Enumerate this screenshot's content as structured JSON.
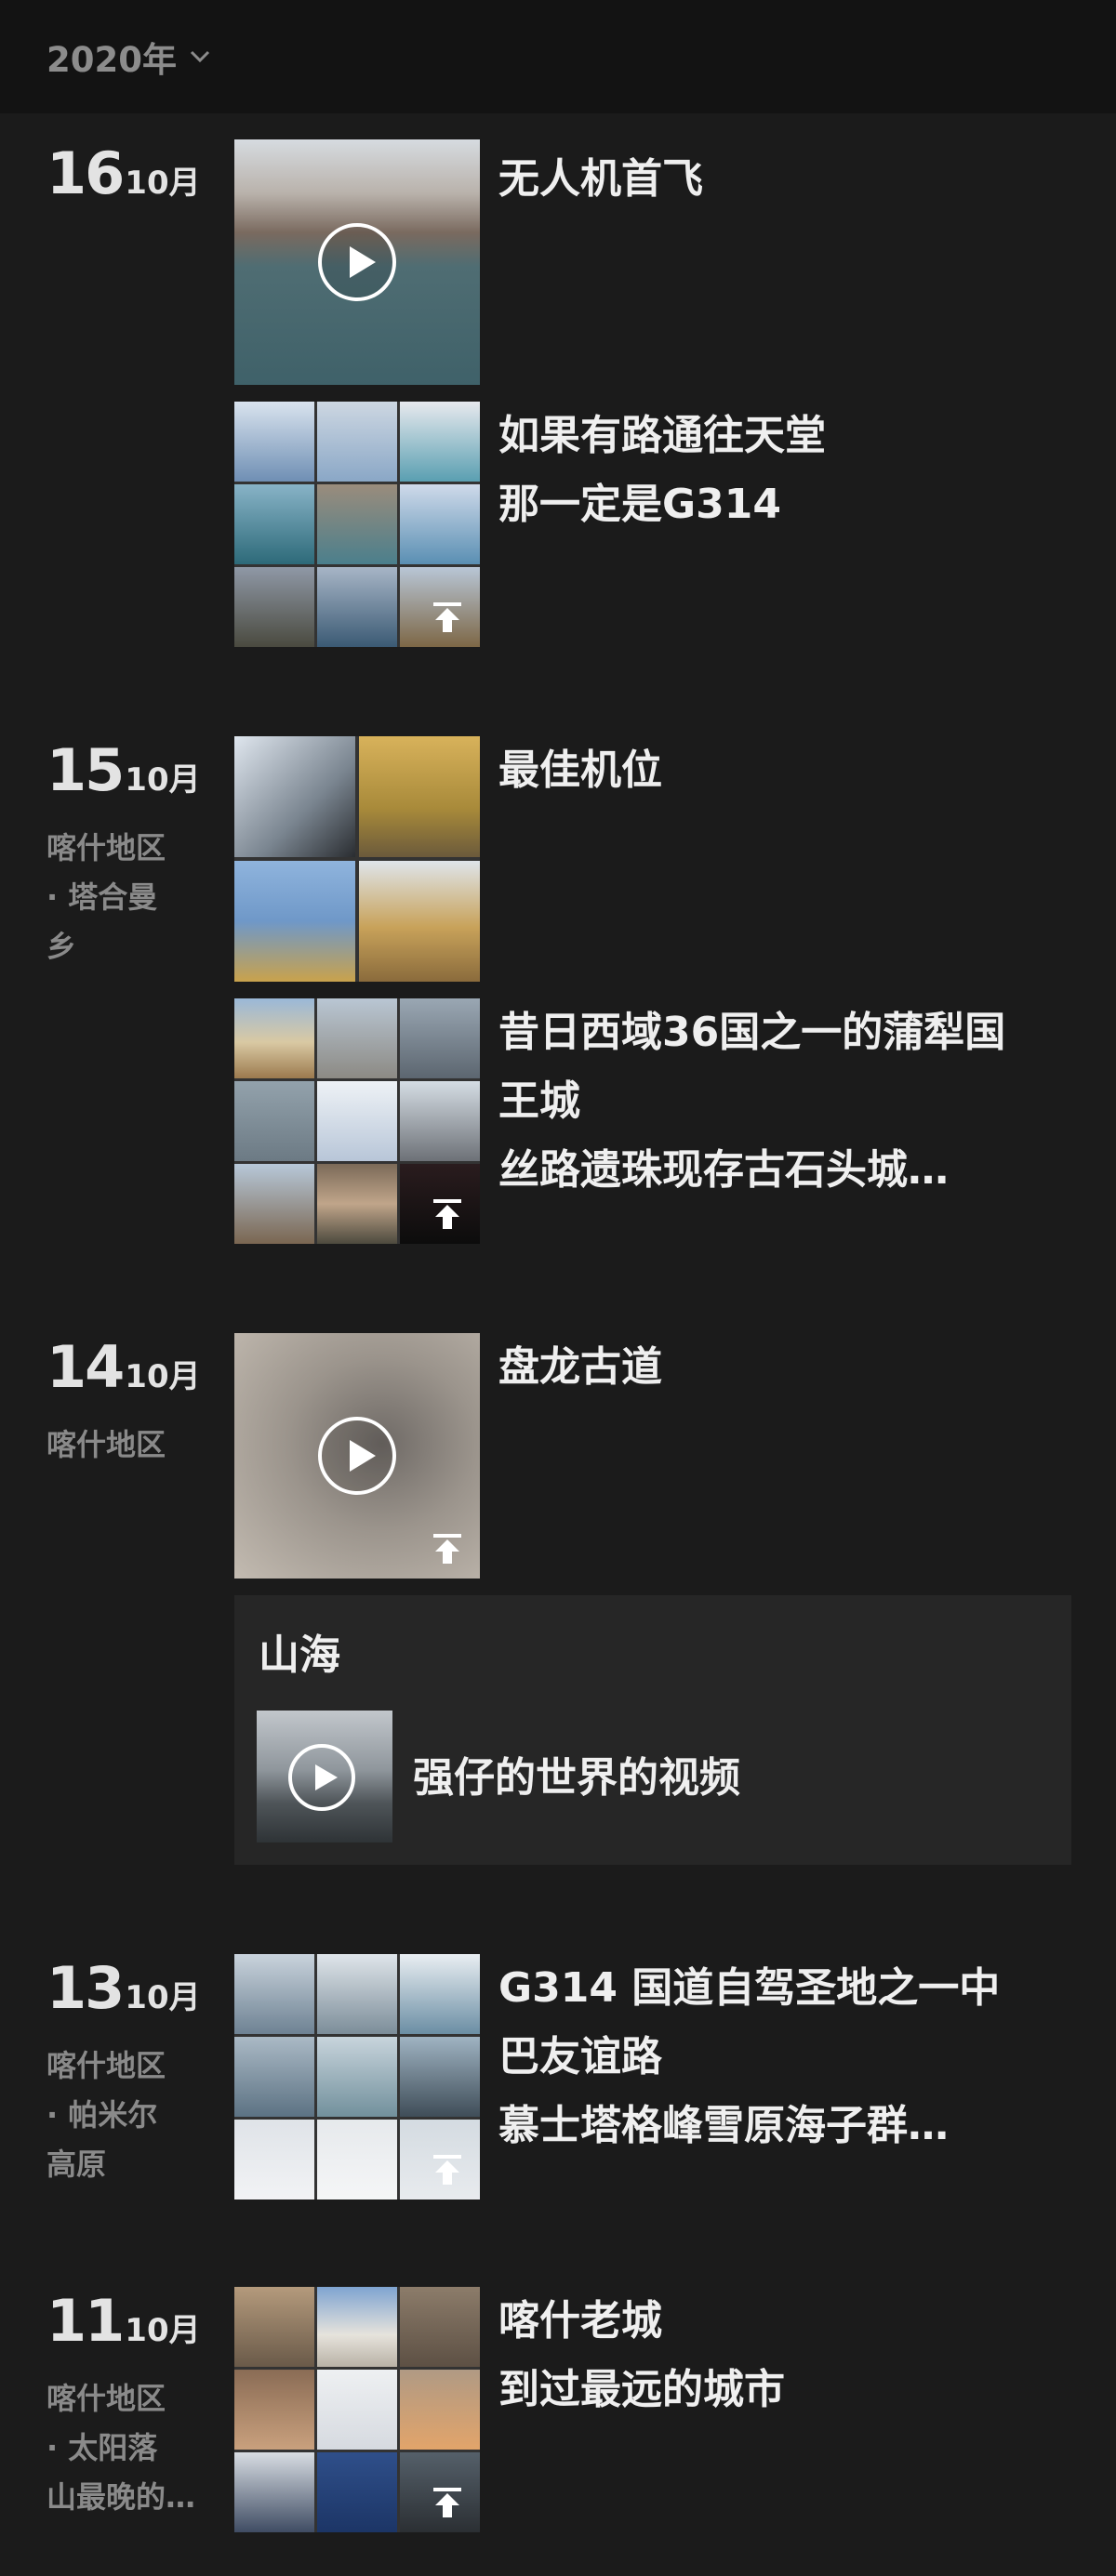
{
  "header": {
    "year": "2020年"
  },
  "days": [
    {
      "day": "16",
      "month": "10月",
      "location": []
    },
    {
      "day": "15",
      "month": "10月",
      "location": [
        "喀什地区",
        "· 塔合曼",
        "乡"
      ]
    },
    {
      "day": "14",
      "month": "10月",
      "location": [
        "喀什地区"
      ]
    },
    {
      "day": "13",
      "month": "10月",
      "location": [
        "喀什地区",
        "· 帕米尔",
        "高原"
      ]
    },
    {
      "day": "11",
      "month": "10月",
      "location": [
        "喀什地区",
        "· 太阳落",
        "山最晚的…"
      ]
    }
  ],
  "posts": [
    {
      "lines": [
        "无人机首飞"
      ]
    },
    {
      "lines": [
        "如果有路通往天堂",
        "那一定是G314"
      ]
    },
    {
      "lines": [
        "最佳机位"
      ]
    },
    {
      "lines": [
        "昔日西域36国之一的蒲犁国",
        "王城",
        "丝路遗珠现存古石头城…"
      ]
    },
    {
      "lines": [
        "盘龙古道"
      ]
    },
    {
      "lines": [
        "G314 国道自驾圣地之一中",
        "巴友谊路",
        "慕士塔格峰雪原海子群…"
      ]
    },
    {
      "lines": [
        "喀什老城",
        "到过最远的城市"
      ]
    }
  ],
  "album_card": {
    "title": "山海",
    "video_label": "强仔的世界的视频"
  },
  "icons": {
    "dropdown": "chevron-down-icon",
    "play": "play-icon",
    "upload": "upload-icon"
  },
  "colors": {
    "background": "#1b1b1b",
    "header": "#131313",
    "card": "#262626",
    "text": "#efefef",
    "muted": "#8a8a8a"
  }
}
